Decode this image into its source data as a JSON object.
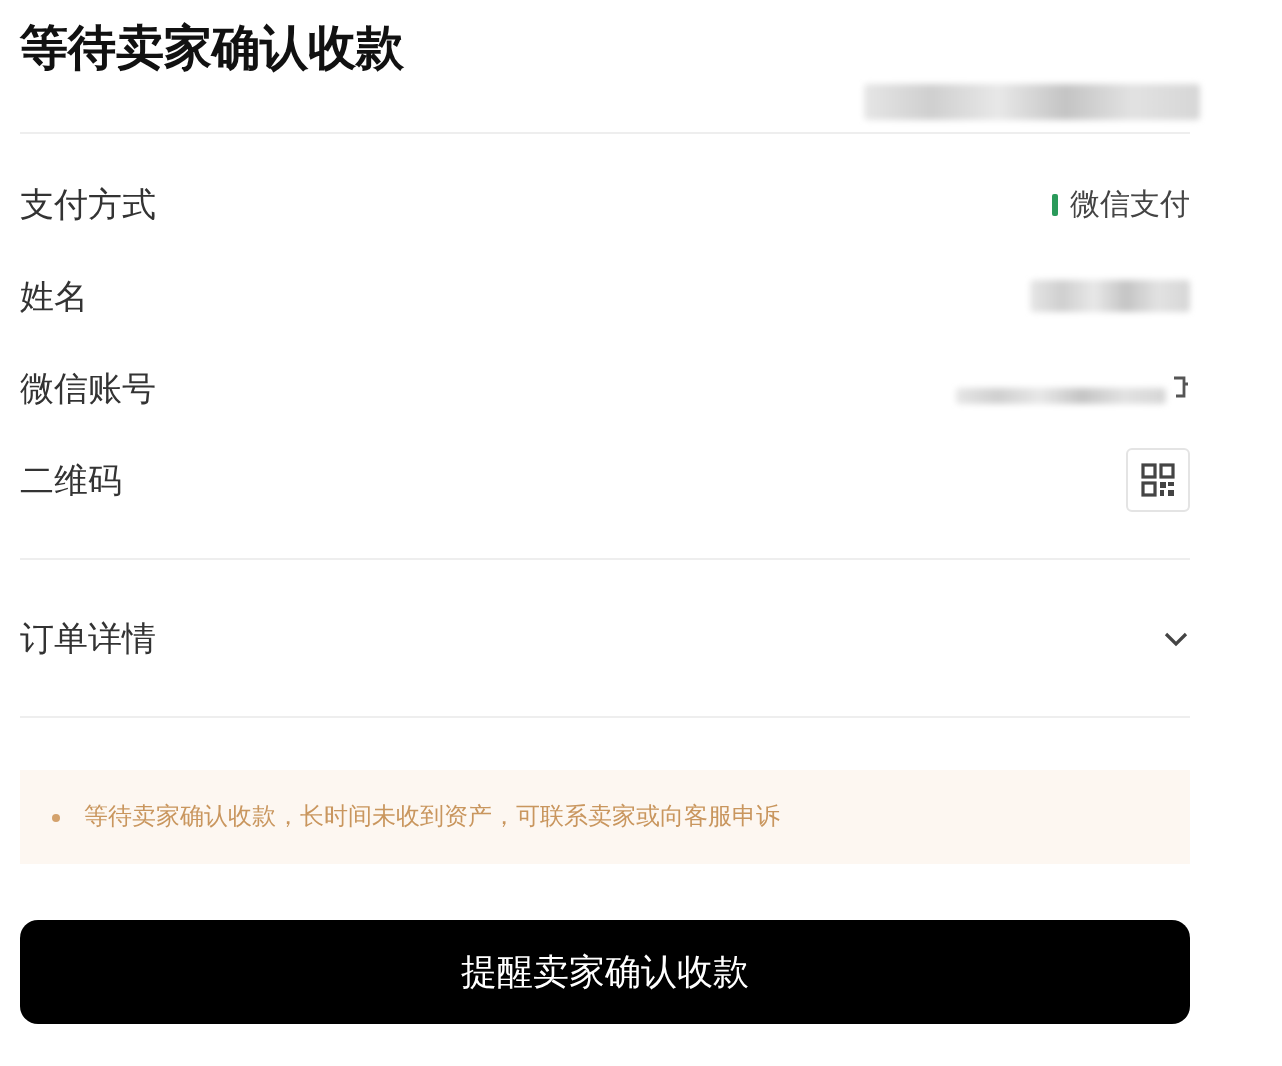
{
  "title": "等待卖家确认收款",
  "rows": [
    {
      "label": "支付方式",
      "kind": "method",
      "value": "微信支付"
    },
    {
      "label": "姓名",
      "kind": "redacted"
    },
    {
      "label": "微信账号",
      "kind": "redacted_copy"
    },
    {
      "label": "二维码",
      "kind": "qr"
    }
  ],
  "order_details": {
    "label": "订单详情",
    "expanded": false
  },
  "notice": "等待卖家确认收款，长时间未收到资产，可联系卖家或向客服申诉",
  "button": "提醒卖家确认收款"
}
